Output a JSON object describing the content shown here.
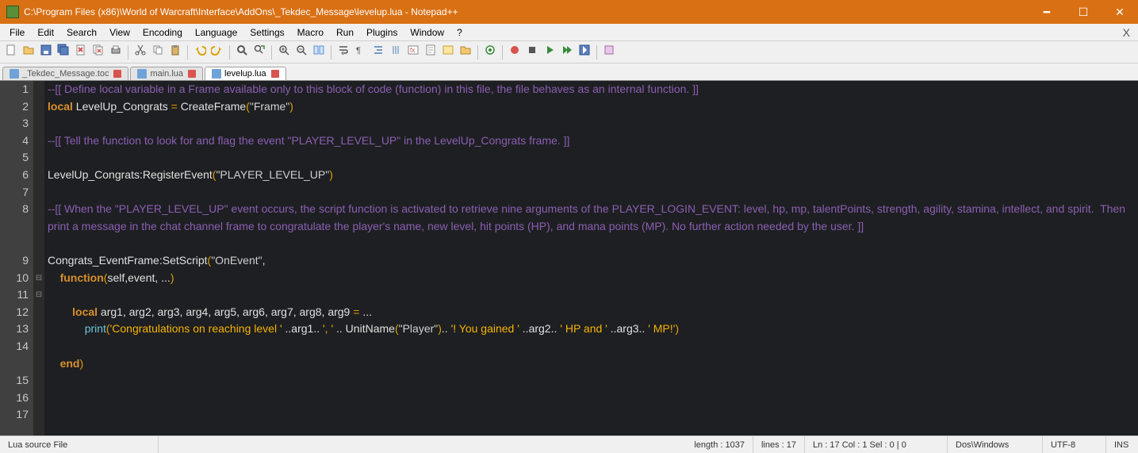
{
  "window": {
    "title": "C:\\Program Files (x86)\\World of Warcraft\\Interface\\AddOns\\_Tekdec_Message\\levelup.lua - Notepad++"
  },
  "menu": {
    "items": [
      "File",
      "Edit",
      "Search",
      "View",
      "Encoding",
      "Language",
      "Settings",
      "Macro",
      "Run",
      "Plugins",
      "Window",
      "?"
    ]
  },
  "tabs": [
    {
      "label": "_Tekdec_Message.toc",
      "active": false
    },
    {
      "label": "main.lua",
      "active": false
    },
    {
      "label": "levelup.lua",
      "active": true
    }
  ],
  "code": {
    "lines": [
      {
        "n": 1,
        "fold": "",
        "seg": [
          [
            "comment",
            "--[[ Define local variable in a Frame available only to this block of code (function) in this file, the file behaves as an internal function. ]]"
          ]
        ]
      },
      {
        "n": 2,
        "fold": "",
        "seg": [
          [
            "keyword",
            "local"
          ],
          [
            "ident",
            " LevelUp_Congrats "
          ],
          [
            "paren",
            "="
          ],
          [
            "ident",
            " CreateFrame"
          ],
          [
            "paren",
            "("
          ],
          [
            "string",
            "\"Frame\""
          ],
          [
            "paren",
            ")"
          ]
        ]
      },
      {
        "n": 3,
        "fold": "",
        "seg": [
          [
            "ident",
            ""
          ]
        ]
      },
      {
        "n": 4,
        "fold": "",
        "seg": [
          [
            "comment",
            "--[[ Tell the function to look for and flag the event \"PLAYER_LEVEL_UP\" in the LevelUp_Congrats frame. ]]"
          ]
        ]
      },
      {
        "n": 5,
        "fold": "",
        "seg": [
          [
            "ident",
            ""
          ]
        ]
      },
      {
        "n": 6,
        "fold": "",
        "seg": [
          [
            "ident",
            "LevelUp_Congrats:RegisterEvent"
          ],
          [
            "paren",
            "("
          ],
          [
            "string",
            "\"PLAYER_LEVEL_UP\""
          ],
          [
            "paren",
            ")"
          ]
        ]
      },
      {
        "n": 7,
        "fold": "",
        "seg": [
          [
            "ident",
            ""
          ]
        ]
      },
      {
        "n": 8,
        "fold": "",
        "seg": [
          [
            "comment",
            "--[[ When the \"PLAYER_LEVEL_UP\" event occurs, the script function is activated to retrieve nine arguments of the PLAYER_LOGIN_EVENT: level, hp, mp, talentPoints, strength, agility, stamina, intellect, and spirit.  Then print a message in the chat channel frame to congratulate the player's name, new level, hit points (HP), and mana points (MP). No further action needed by the user. ]]"
          ]
        ],
        "wrap": true
      },
      {
        "n": 9,
        "fold": "",
        "seg": [
          [
            "ident",
            ""
          ]
        ]
      },
      {
        "n": 10,
        "fold": "⊟",
        "seg": [
          [
            "ident",
            "Congrats_EventFrame:SetScript"
          ],
          [
            "paren",
            "("
          ],
          [
            "string",
            "\"OnEvent\""
          ],
          [
            "ident",
            ","
          ]
        ]
      },
      {
        "n": 11,
        "fold": "⊟",
        "seg": [
          [
            "ident",
            "    "
          ],
          [
            "keyword",
            "function"
          ],
          [
            "paren",
            "("
          ],
          [
            "ident",
            "self,event, ..."
          ],
          [
            "paren",
            ")"
          ]
        ]
      },
      {
        "n": 12,
        "fold": "",
        "seg": [
          [
            "ident",
            ""
          ]
        ]
      },
      {
        "n": 13,
        "fold": "",
        "seg": [
          [
            "ident",
            "        "
          ],
          [
            "keyword",
            "local"
          ],
          [
            "ident",
            " arg1, arg2, arg3, arg4, arg5, arg6, arg7, arg8, arg9 "
          ],
          [
            "paren",
            "="
          ],
          [
            "ident",
            " ..."
          ]
        ]
      },
      {
        "n": 14,
        "fold": "",
        "seg": [
          [
            "ident",
            "            "
          ],
          [
            "func",
            "print"
          ],
          [
            "paren",
            "("
          ],
          [
            "string2",
            "'Congratulations on reaching level '"
          ],
          [
            "ident",
            " ..arg1.. "
          ],
          [
            "string2",
            "', '"
          ],
          [
            "ident",
            " .. UnitName"
          ],
          [
            "paren",
            "("
          ],
          [
            "string",
            "\"Player\""
          ],
          [
            "paren",
            ")"
          ],
          [
            "ident",
            ".. "
          ],
          [
            "string2",
            "'! You gained '"
          ],
          [
            "ident",
            " ..arg2.. "
          ],
          [
            "string2",
            "' HP and '"
          ],
          [
            "ident",
            " ..arg3.. "
          ],
          [
            "string2",
            "' MP!'"
          ],
          [
            "paren",
            ")"
          ]
        ],
        "wrap": true
      },
      {
        "n": 15,
        "fold": "",
        "seg": [
          [
            "ident",
            ""
          ]
        ]
      },
      {
        "n": 16,
        "fold": "",
        "seg": [
          [
            "ident",
            "    "
          ],
          [
            "keyword",
            "end"
          ],
          [
            "paren",
            ")"
          ]
        ]
      },
      {
        "n": 17,
        "fold": "",
        "seg": [
          [
            "ident",
            ""
          ]
        ]
      }
    ]
  },
  "status": {
    "filetype": "Lua source File",
    "length": "length : 1037",
    "lines": "lines : 17",
    "pos": "Ln : 17   Col : 1   Sel : 0 | 0",
    "eol": "Dos\\Windows",
    "encoding": "UTF-8",
    "ins": "INS"
  },
  "toolbar_icons": [
    "new",
    "open",
    "save",
    "save-all",
    "close",
    "close-all",
    "print",
    "sep",
    "cut",
    "copy",
    "paste",
    "sep",
    "undo",
    "redo",
    "sep",
    "find",
    "replace",
    "sep",
    "zoom-in",
    "zoom-out",
    "sync",
    "sep",
    "wrap",
    "all-chars",
    "indent",
    "guide",
    "lang",
    "doc-map",
    "func-list",
    "folder",
    "sep",
    "monitor",
    "sep",
    "record",
    "stop",
    "play",
    "play-multi",
    "save-macro",
    "sep",
    "extra"
  ]
}
